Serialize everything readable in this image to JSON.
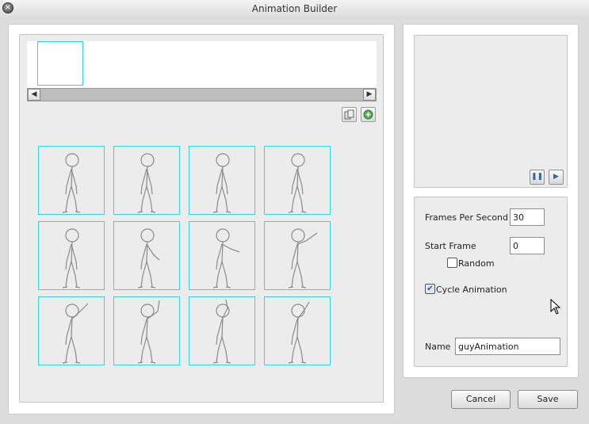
{
  "window": {
    "title": "Animation Builder",
    "close_icon": "close-icon"
  },
  "timeline": {
    "frames_in_strip": 1
  },
  "toolbar": {
    "icons": [
      "copy-frames-icon",
      "add-frame-icon"
    ]
  },
  "frames": [
    {
      "pose": "stand"
    },
    {
      "pose": "stand"
    },
    {
      "pose": "stand"
    },
    {
      "pose": "stand"
    },
    {
      "pose": "stand"
    },
    {
      "pose": "arm-out-low"
    },
    {
      "pose": "arm-out-mid"
    },
    {
      "pose": "arm-out-high"
    },
    {
      "pose": "arm-raise"
    },
    {
      "pose": "arm-up"
    },
    {
      "pose": "arm-up-bent"
    },
    {
      "pose": "arm-wave"
    }
  ],
  "preview": {
    "pause_icon": "pause-icon",
    "play_icon": "play-icon"
  },
  "settings": {
    "fps_label": "Frames Per Second",
    "fps_value": "30",
    "start_frame_label": "Start Frame",
    "start_frame_value": "0",
    "random_label": "Random",
    "random_checked": false,
    "cycle_label": "Cycle Animation",
    "cycle_checked": true,
    "name_label": "Name",
    "name_value": "guyAnimation"
  },
  "buttons": {
    "cancel": "Cancel",
    "save": "Save"
  },
  "colors": {
    "frame_border": "#33d6e0",
    "panel_bg": "#ececec"
  }
}
